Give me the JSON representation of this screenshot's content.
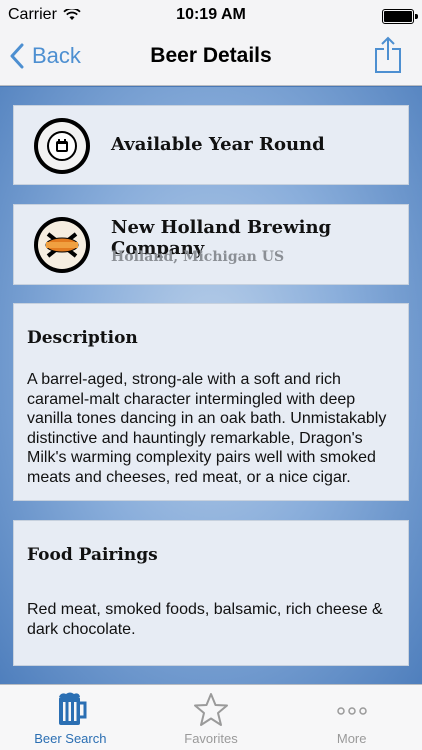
{
  "status_bar": {
    "carrier": "Carrier",
    "time": "10:19 AM"
  },
  "nav": {
    "back_label": "Back",
    "title": "Beer Details",
    "share_icon": "share-icon"
  },
  "availability": {
    "text": "Available Year Round",
    "icon": "calendar-icon"
  },
  "brewery": {
    "name": "New Holland Brewing Company",
    "location": "Holland, Michigan US",
    "logo": "new-holland-logo"
  },
  "description": {
    "heading": "Description",
    "text": "A barrel-aged, strong-ale with a soft and rich caramel-malt character intermingled with deep vanilla tones dancing in an oak bath. Unmistakably distinctive and hauntingly remarkable, Dragon's Milk's warming complexity pairs well with smoked meats and cheeses, red meat, or a nice cigar."
  },
  "food_pairings": {
    "heading": "Food Pairings",
    "text": "Red meat, smoked foods, balsamic, rich cheese & dark chocolate."
  },
  "tabs": [
    {
      "label": "Beer Search",
      "icon": "beer-mug-icon",
      "active": true
    },
    {
      "label": "Favorites",
      "icon": "star-icon",
      "active": false
    },
    {
      "label": "More",
      "icon": "more-dots-icon",
      "active": false
    }
  ],
  "colors": {
    "accent": "#4d8fd1",
    "tab_active": "#2b6fb3",
    "background": "#4a78b4"
  }
}
